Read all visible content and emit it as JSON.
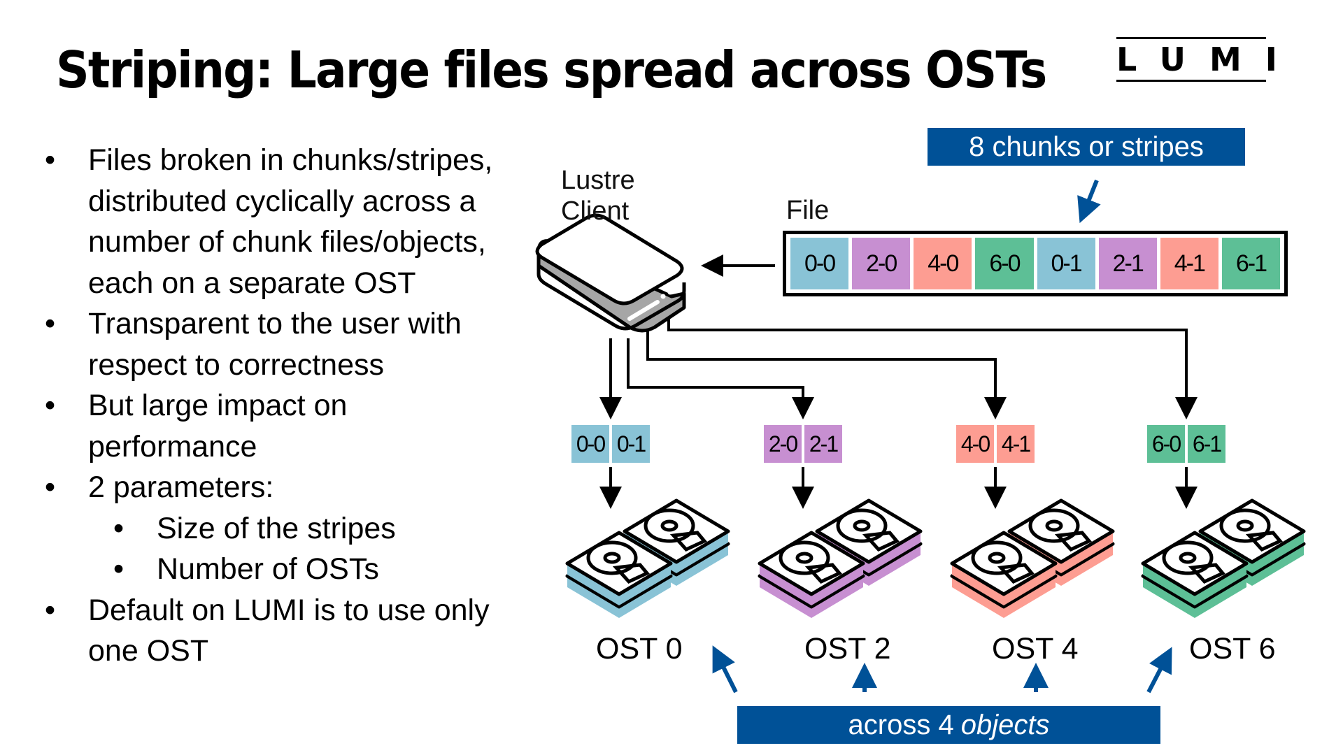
{
  "slide": {
    "title": "Striping: Large files spread across OSTs",
    "logo": "LUMI"
  },
  "bullets": [
    {
      "level": 1,
      "lines": [
        "Files broken in chunks/stripes,",
        "distributed cyclically across a",
        "number of chunk files/objects,",
        "each on a separate OST"
      ]
    },
    {
      "level": 1,
      "lines": [
        "Transparent to the user with",
        "respect to correctness"
      ]
    },
    {
      "level": 1,
      "lines": [
        "But large impact on",
        "performance"
      ]
    },
    {
      "level": 1,
      "lines": [
        "2 parameters:"
      ]
    },
    {
      "level": 2,
      "lines": [
        "Size of the stripes"
      ]
    },
    {
      "level": 2,
      "lines": [
        "Number of OSTs"
      ]
    },
    {
      "level": 1,
      "lines": [
        "Default on LUMI is to use only",
        "one OST"
      ]
    }
  ],
  "diagram": {
    "client_label_line1": "Lustre",
    "client_label_line2": "Client",
    "file_label": "File",
    "top_banner": "8 chunks or stripes",
    "bottom_banner_plain": "across 4",
    "bottom_banner_italic": "objects",
    "colors": {
      "ost0": "#89c3d6",
      "ost2": "#c78fd1",
      "ost4": "#fd9d92",
      "ost6": "#5dbf96",
      "banner": "#005197",
      "client_side": "#a6a6a6"
    },
    "file_chunks": [
      {
        "label": "0-0",
        "ost": "ost0"
      },
      {
        "label": "2-0",
        "ost": "ost2"
      },
      {
        "label": "4-0",
        "ost": "ost4"
      },
      {
        "label": "6-0",
        "ost": "ost6"
      },
      {
        "label": "0-1",
        "ost": "ost0"
      },
      {
        "label": "2-1",
        "ost": "ost2"
      },
      {
        "label": "4-1",
        "ost": "ost4"
      },
      {
        "label": "6-1",
        "ost": "ost6"
      }
    ],
    "osts": [
      {
        "name": "OST 0",
        "key": "ost0",
        "chunks": [
          "0-0",
          "0-1"
        ]
      },
      {
        "name": "OST 2",
        "key": "ost2",
        "chunks": [
          "2-0",
          "2-1"
        ]
      },
      {
        "name": "OST 4",
        "key": "ost4",
        "chunks": [
          "4-0",
          "4-1"
        ]
      },
      {
        "name": "OST 6",
        "key": "ost6",
        "chunks": [
          "6-0",
          "6-1"
        ]
      }
    ]
  }
}
